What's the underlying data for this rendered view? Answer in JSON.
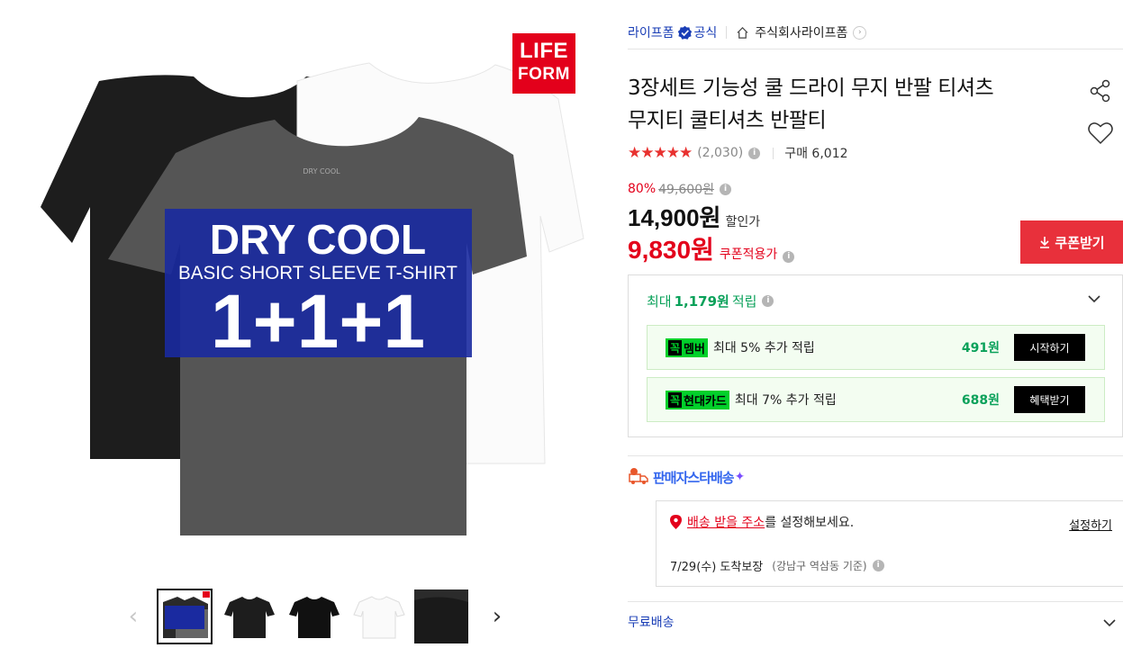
{
  "brand_logo": {
    "line1": "LIFE",
    "line2": "FORM"
  },
  "image_text": {
    "headline": "DRY COOL",
    "subline": "BASIC SHORT SLEEVE T-SHIRT",
    "bundle": "1+1+1",
    "tag": "DRY COOL"
  },
  "seller": {
    "name": "라이프폼",
    "official": "공식",
    "store": "주식회사라이프폼"
  },
  "product": {
    "title_line1": "3장세트 기능성 쿨 드라이 무지 반팔 티셔츠",
    "title_line2": "무지티 쿨티셔츠 반팔티"
  },
  "rating": {
    "stars": "★★★★★",
    "score_fraction": 0.9,
    "reviews": "(2,030)",
    "purchase": "구매 6,012"
  },
  "price": {
    "discount_rate": "80%",
    "original": "49,600원",
    "sale": "14,900원",
    "sale_label": "할인가",
    "coupon": "9,830원",
    "coupon_label": "쿠폰적용가",
    "coupon_button": "쿠폰받기"
  },
  "points": {
    "prefix": "최대",
    "amount": "1,179원",
    "suffix": "적립",
    "benefits": [
      {
        "badge_k": "꼭",
        "badge": "멤버",
        "text": "최대 5% 추가 적립",
        "amount": "491원",
        "button": "시작하기"
      },
      {
        "badge_k": "꼭",
        "badge": "현대카드",
        "text": "최대 7% 추가 적립",
        "amount": "688원",
        "button": "혜택받기"
      }
    ]
  },
  "delivery": {
    "brand": "판매자스타배송",
    "sparkle": "✦",
    "address_link": "배송 받을 주소",
    "address_rest": "를 설정해보세요.",
    "set_button": "설정하기",
    "arrival": "7/29(수) 도착보장",
    "arrival_sub": "(강남구 역삼동 기준)"
  },
  "shipping": {
    "label": "무료배송"
  },
  "thumbnail_nav": {
    "prev": "‹",
    "next": "›"
  },
  "colors": {
    "accent_red": "#e3001b",
    "link_blue": "#1a3eb6",
    "green": "#0aa15a",
    "badge_green": "#00d02a"
  }
}
